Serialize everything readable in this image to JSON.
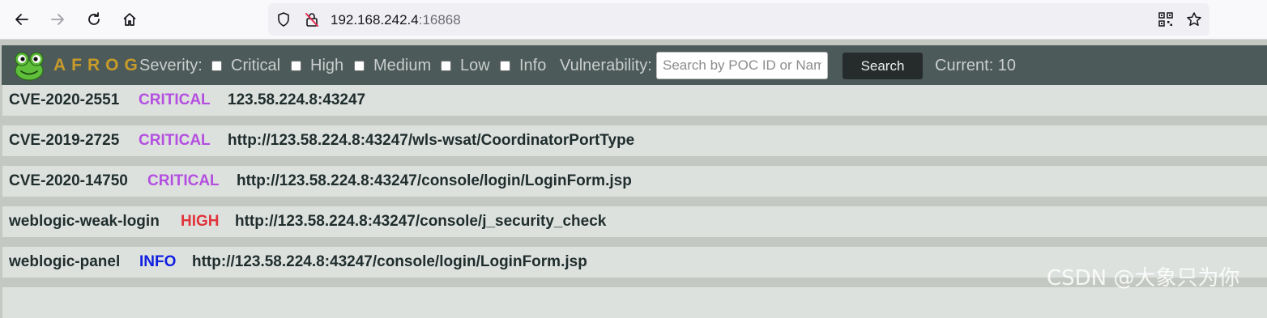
{
  "browser": {
    "url_host": "192.168.242.4",
    "url_port": ":16868",
    "back_icon": "arrow-left-icon",
    "forward_icon": "arrow-right-icon",
    "reload_icon": "reload-icon",
    "home_icon": "home-icon",
    "shield_icon": "shield-icon",
    "insecure_icon": "lock-insecure-icon",
    "qr_icon": "qr-code-icon",
    "bookmark_icon": "star-icon"
  },
  "header": {
    "brand": "AFROG",
    "severity_label": "Severity:",
    "filters": [
      "Critical",
      "High",
      "Medium",
      "Low",
      "Info"
    ],
    "vuln_label": "Vulnerability:",
    "search_placeholder": "Search by POC ID or Name",
    "search_button": "Search",
    "current_label": "Current: 10"
  },
  "results": [
    {
      "poc": "CVE-2020-2551",
      "severity": "CRITICAL",
      "url": "123.58.224.8:43247"
    },
    {
      "poc": "CVE-2019-2725",
      "severity": "CRITICAL",
      "url": "http://123.58.224.8:43247/wls-wsat/CoordinatorPortType"
    },
    {
      "poc": "CVE-2020-14750",
      "severity": "CRITICAL",
      "url": "http://123.58.224.8:43247/console/login/LoginForm.jsp"
    },
    {
      "poc": "weblogic-weak-login",
      "severity": "HIGH",
      "url": "http://123.58.224.8:43247/console/j_security_check"
    },
    {
      "poc": "weblogic-panel",
      "severity": "INFO",
      "url": "http://123.58.224.8:43247/console/login/LoginForm.jsp"
    }
  ],
  "colors": {
    "critical": "#b44fe0",
    "high": "#e1343c",
    "info": "#0f1ee0",
    "header_bg": "#4c5a5a",
    "brand": "#c89b2a"
  },
  "watermark": "CSDN @大象只为你"
}
